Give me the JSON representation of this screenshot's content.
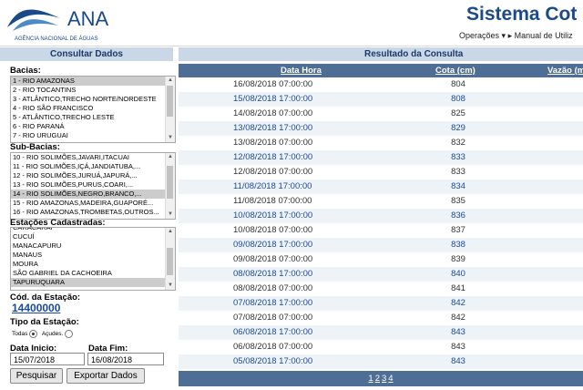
{
  "header": {
    "logo_text": "ANA",
    "logo_subtitle": "AGÊNCIA NACIONAL DE ÁGUAS",
    "title": "Sistema Cot",
    "nav": [
      "Operações",
      "Manual de Utiliz"
    ]
  },
  "left_panel": {
    "title": "Consultar Dados",
    "bacias_label": "Bacias:",
    "bacias": [
      "1 - RIO AMAZONAS",
      "2 - RIO TOCANTINS",
      "3 - ATLÂNTICO,TRECHO NORTE/NORDESTE",
      "4 - RIO SÃO FRANCISCO",
      "5 - ATLÂNTICO,TRECHO LESTE",
      "6 - RIO PARANÁ",
      "7 - RIO URUGUAI"
    ],
    "bacias_selected": 0,
    "subbacias_label": "Sub-Bacias:",
    "subbacias": [
      "10 - RIO SOLIMÕES,JAVARI,ITACUAI",
      "11 - RIO SOLIMÕES,IÇÁ,JANDIATUBA,...",
      "12 - RIO SOLIMÕES,JURUÁ,JAPURÁ,...",
      "13 - RIO SOLIMÕES,PURUS,COARI,...",
      "14 - RIO SOLIMÕES,NEGRO,BRANCO,...",
      "15 - RIO AMAZONAS,MADEIRA,GUAPORÉ...",
      "16 - RIO AMAZONAS,TROMBETAS,OUTROS..."
    ],
    "subbacias_selected": 4,
    "estacoes_label": "Estações Cadastradas:",
    "estacoes": [
      "CARACARAÍ",
      "CUCUÍ",
      "MANACAPURU",
      "MANAUS",
      "MOURA",
      "SÃO GABRIEL DA CACHOEIRA",
      "TAPURUQUARA"
    ],
    "estacoes_selected": 6,
    "cod_label": "Cód. da Estação:",
    "cod_value": "14400000",
    "tipo_label": "Tipo da Estação:",
    "tipo_options": [
      "Todas",
      "Açudes."
    ],
    "tipo_selected": 0,
    "data_inicio_label": "Data Inicio:",
    "data_inicio": "15/07/2018",
    "data_fim_label": "Data Fim:",
    "data_fim": "16/08/2018",
    "btn_pesquisar": "Pesquisar",
    "btn_exportar": "Exportar Dados"
  },
  "results": {
    "title": "Resultado da Consulta",
    "columns": [
      "Data Hora",
      "Cota (cm)",
      "Vazão (m"
    ],
    "rows": [
      {
        "datetime": "16/08/2018 07:00:00",
        "cota": "804"
      },
      {
        "datetime": "15/08/2018 17:00:00",
        "cota": "808"
      },
      {
        "datetime": "14/08/2018 07:00:00",
        "cota": "825"
      },
      {
        "datetime": "13/08/2018 17:00:00",
        "cota": "829"
      },
      {
        "datetime": "13/08/2018 07:00:00",
        "cota": "832"
      },
      {
        "datetime": "12/08/2018 17:00:00",
        "cota": "833"
      },
      {
        "datetime": "12/08/2018 07:00:00",
        "cota": "833"
      },
      {
        "datetime": "11/08/2018 17:00:00",
        "cota": "834"
      },
      {
        "datetime": "11/08/2018 07:00:00",
        "cota": "835"
      },
      {
        "datetime": "10/08/2018 17:00:00",
        "cota": "836"
      },
      {
        "datetime": "10/08/2018 07:00:00",
        "cota": "837"
      },
      {
        "datetime": "09/08/2018 17:00:00",
        "cota": "838"
      },
      {
        "datetime": "09/08/2018 07:00:00",
        "cota": "839"
      },
      {
        "datetime": "08/08/2018 17:00:00",
        "cota": "840"
      },
      {
        "datetime": "08/08/2018 07:00:00",
        "cota": "841"
      },
      {
        "datetime": "07/08/2018 17:00:00",
        "cota": "842"
      },
      {
        "datetime": "07/08/2018 07:00:00",
        "cota": "842"
      },
      {
        "datetime": "06/08/2018 17:00:00",
        "cota": "843"
      },
      {
        "datetime": "06/08/2018 07:00:00",
        "cota": "843"
      },
      {
        "datetime": "05/08/2018 17:00:00",
        "cota": "843"
      }
    ],
    "pages": [
      "1",
      "2",
      "3",
      "4"
    ]
  },
  "colors": {
    "brand_blue": "#1a4a8a",
    "table_header": "#4f6e95",
    "panel_title_bg": "#c9d7e6"
  }
}
